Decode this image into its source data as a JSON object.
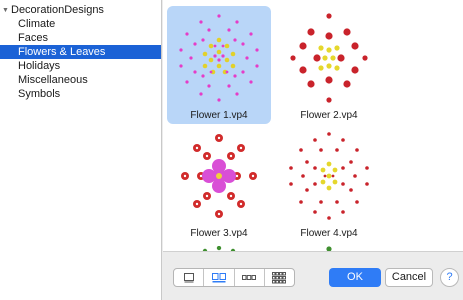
{
  "sidebar": {
    "root": {
      "label": "DecorationDesigns",
      "expanded": true
    },
    "items": [
      {
        "label": "Climate"
      },
      {
        "label": "Faces"
      },
      {
        "label": "Flowers & Leaves",
        "selected": true
      },
      {
        "label": "Holidays"
      },
      {
        "label": "Miscellaneous"
      },
      {
        "label": "Symbols"
      }
    ]
  },
  "browser": {
    "tiles": [
      {
        "label": "Flower 1.vp4",
        "selected": true
      },
      {
        "label": "Flower 2.vp4"
      },
      {
        "label": "Flower 3.vp4"
      },
      {
        "label": "Flower 4.vp4"
      }
    ]
  },
  "footer": {
    "view_modes": [
      {
        "icon": "single-view-icon",
        "selected": false
      },
      {
        "icon": "two-column-grid-icon",
        "selected": true
      },
      {
        "icon": "three-column-grid-icon",
        "selected": false
      },
      {
        "icon": "four-column-grid-icon",
        "selected": false
      }
    ],
    "ok_label": "OK",
    "cancel_label": "Cancel",
    "help_label": "?"
  },
  "colors": {
    "selection": "#1b62d6",
    "tile_selection": "#b9d6f8",
    "accent": "#2f7cf6"
  }
}
